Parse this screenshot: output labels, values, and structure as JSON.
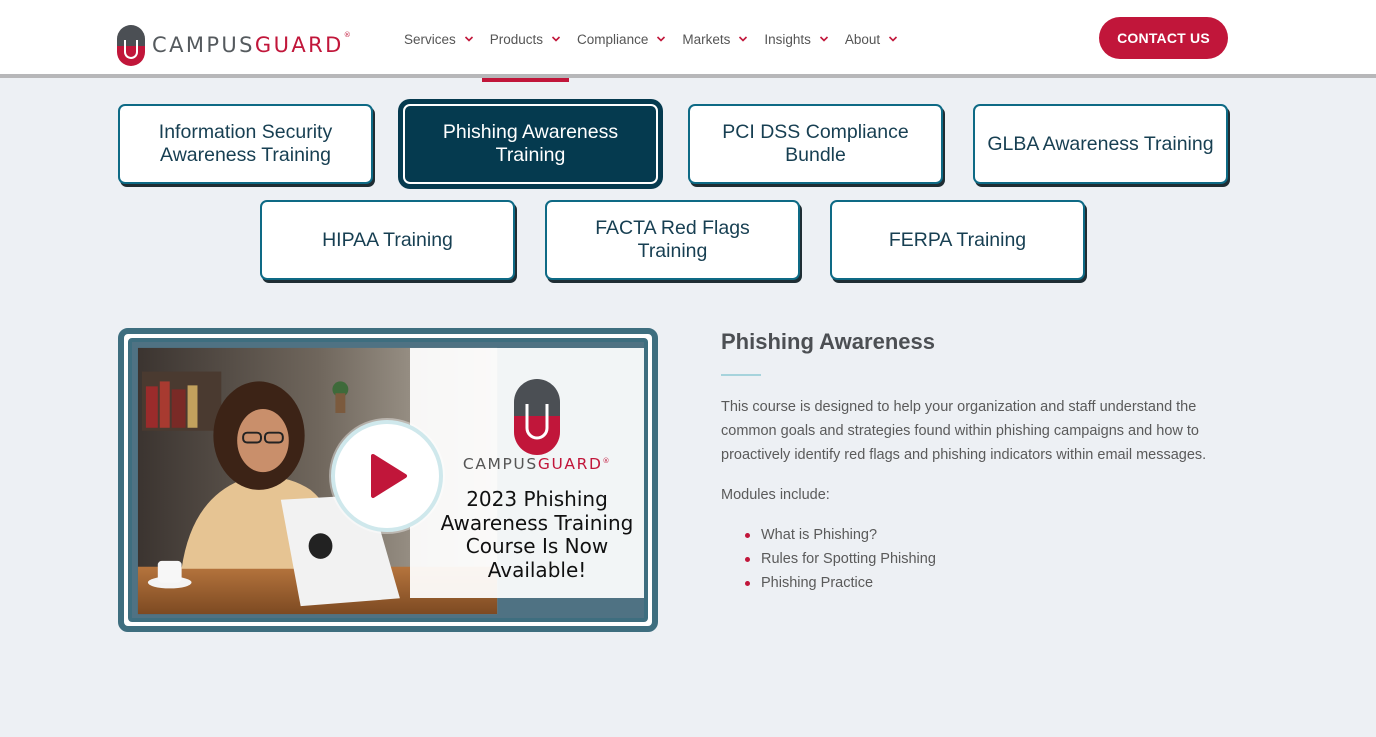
{
  "header": {
    "logo": {
      "part1": "CAMPUS",
      "part2": "GUARD",
      "registered": "®"
    },
    "nav": [
      {
        "label": "Services",
        "active": false
      },
      {
        "label": "Products",
        "active": true
      },
      {
        "label": "Compliance",
        "active": false
      },
      {
        "label": "Markets",
        "active": false
      },
      {
        "label": "Insights",
        "active": false
      },
      {
        "label": "About",
        "active": false
      }
    ],
    "contact_label": "CONTACT US"
  },
  "tabs": [
    {
      "label": "Information Security Awareness Training",
      "active": false
    },
    {
      "label": "Phishing Awareness Training",
      "active": true
    },
    {
      "label": "PCI DSS Compliance Bundle",
      "active": false
    },
    {
      "label": "GLBA Awareness Training",
      "active": false
    },
    {
      "label": "HIPAA Training",
      "active": false
    },
    {
      "label": "FACTA Red Flags Training",
      "active": false
    },
    {
      "label": "FERPA Training",
      "active": false
    }
  ],
  "video": {
    "logo_part1": "CAMPUS",
    "logo_part2": "GUARD",
    "logo_registered": "®",
    "promo_text": "2023 Phishing Awareness Training Course Is Now Available!",
    "play_icon": "play-icon"
  },
  "content": {
    "heading": "Phishing Awareness",
    "description": "This course is designed to help your organization and staff understand the common goals and strategies found within phishing campaigns and how to proactively identify red flags and phishing indicators within email messages.",
    "modules_intro": "Modules include:",
    "modules": [
      "What is Phishing?",
      "Rules for Spotting Phishing",
      "Phishing Practice"
    ]
  },
  "colors": {
    "brand_red": "#c1163a",
    "brand_teal": "#053a4f",
    "background": "#edf0f4"
  }
}
